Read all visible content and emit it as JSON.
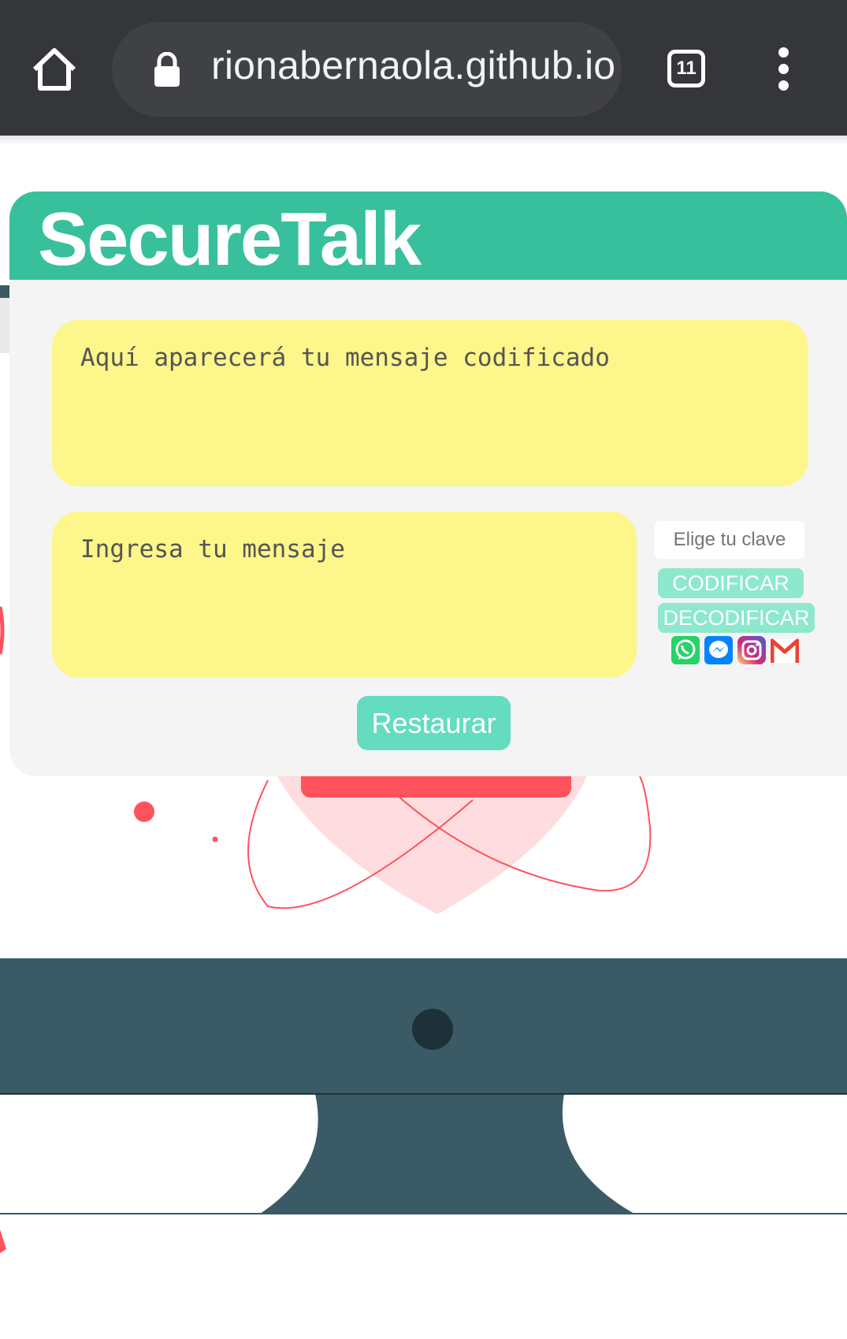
{
  "browser": {
    "url": "rionabernaola.github.io",
    "tab_count": "11",
    "icons": [
      "home-icon",
      "lock-icon",
      "tabs-icon",
      "more-vert-icon"
    ]
  },
  "app": {
    "title": "SecureTalk",
    "output_placeholder": "Aquí aparecerá tu mensaje codificado",
    "input_placeholder": "Ingresa tu mensaje",
    "key_placeholder": "Elige tu clave",
    "encode_label": "CODIFICAR",
    "decode_label": "DECODIFICAR",
    "reset_label": "Restaurar",
    "share_icons": [
      "whatsapp-icon",
      "messenger-icon",
      "instagram-icon",
      "gmail-icon"
    ]
  },
  "colors": {
    "header": "#37c09b",
    "textbox": "#fdf68a",
    "button": "#64dcbf",
    "monitor": "#3a5a66",
    "accent_red": "#ff525d"
  }
}
